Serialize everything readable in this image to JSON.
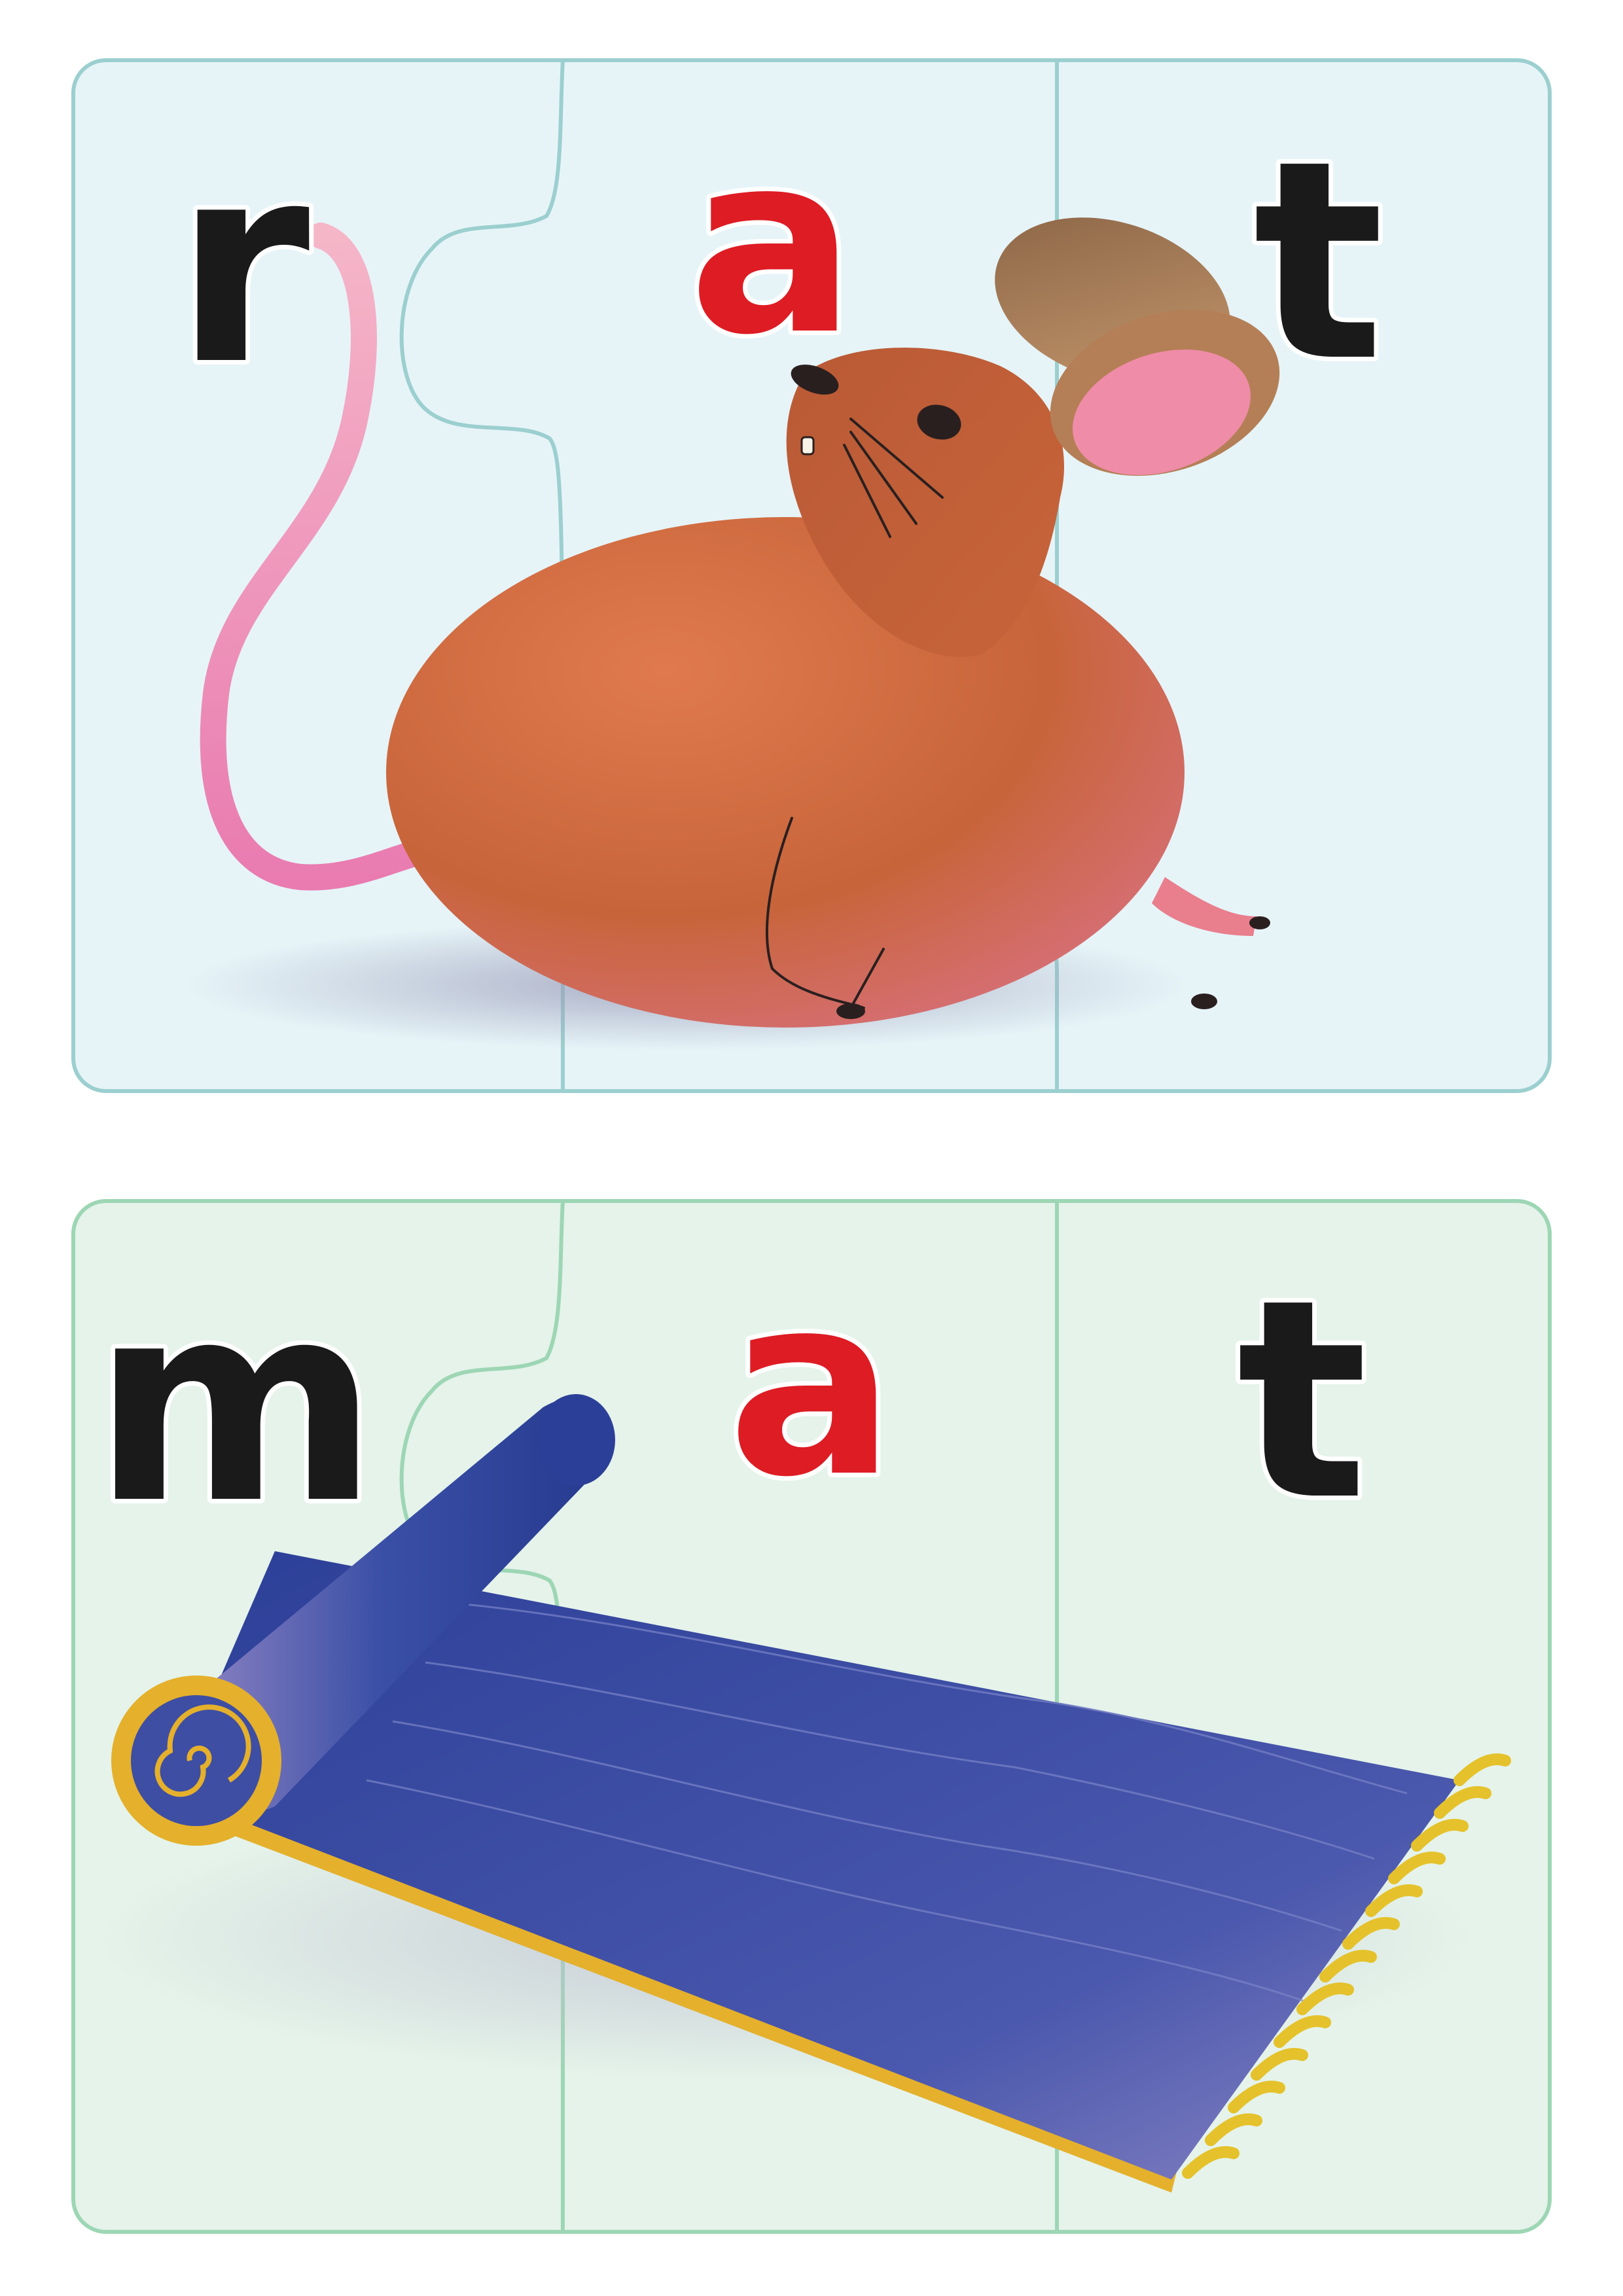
{
  "colors": {
    "background": "#ffffff",
    "rat_card_fill": "#e6f4f8",
    "rat_card_border": "#9ccfcf",
    "mat_card_fill": "#e5f3ea",
    "mat_card_border": "#9dd6b4",
    "consonant_color": "#1a1a1a",
    "vowel_color": "#de1c24",
    "rat_body": "#c8643a",
    "rat_ear": "#a47552",
    "rat_ear_inner": "#ef8ca8",
    "rat_tail": "#ec8fb6",
    "mat_blue": "#3e4ea3",
    "mat_gold": "#e5b02b"
  },
  "puzzles": [
    {
      "word": "rat",
      "picture": "rat",
      "pieces": [
        {
          "letter": "r",
          "type": "consonant"
        },
        {
          "letter": "a",
          "type": "vowel"
        },
        {
          "letter": "t",
          "type": "consonant"
        }
      ]
    },
    {
      "word": "mat",
      "picture": "mat",
      "pieces": [
        {
          "letter": "m",
          "type": "consonant"
        },
        {
          "letter": "a",
          "type": "vowel"
        },
        {
          "letter": "t",
          "type": "consonant"
        }
      ]
    }
  ]
}
